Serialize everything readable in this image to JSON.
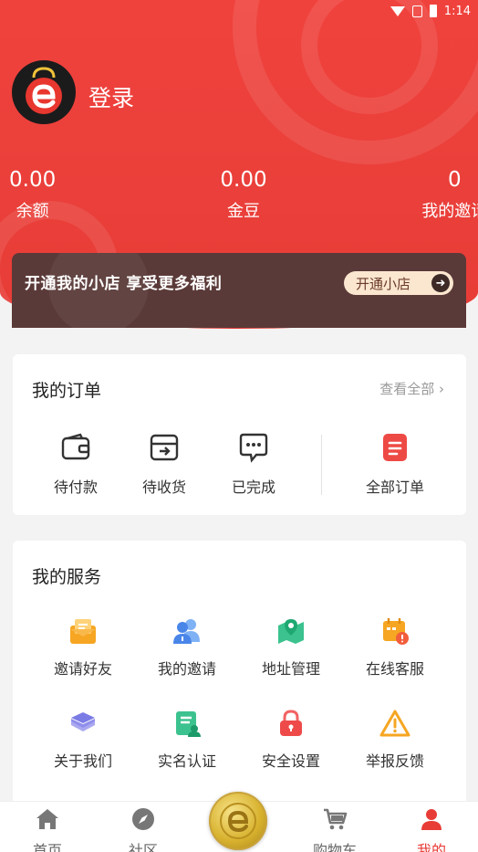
{
  "status_bar": {
    "time": "1:14"
  },
  "profile": {
    "login_label": "登录"
  },
  "stats": [
    {
      "value": "0.00",
      "label": "余额"
    },
    {
      "value": "0.00",
      "label": "金豆"
    },
    {
      "value": "0",
      "label": "我的邀请"
    }
  ],
  "shop_banner": {
    "text": "开通我的小店 享受更多福利",
    "button_label": "开通小店"
  },
  "orders": {
    "title": "我的订单",
    "view_all": "查看全部",
    "items": [
      {
        "label": "待付款",
        "icon": "wallet-icon"
      },
      {
        "label": "待收货",
        "icon": "receive-box-icon"
      },
      {
        "label": "已完成",
        "icon": "chat-dots-icon"
      },
      {
        "label": "全部订单",
        "icon": "document-icon"
      }
    ]
  },
  "services": {
    "title": "我的服务",
    "items": [
      {
        "label": "邀请好友",
        "icon": "mail-icon"
      },
      {
        "label": "我的邀请",
        "icon": "users-icon"
      },
      {
        "label": "地址管理",
        "icon": "map-pin-icon"
      },
      {
        "label": "在线客服",
        "icon": "calendar-alert-icon"
      },
      {
        "label": "关于我们",
        "icon": "layers-icon"
      },
      {
        "label": "实名认证",
        "icon": "id-card-icon"
      },
      {
        "label": "安全设置",
        "icon": "lock-icon"
      },
      {
        "label": "举报反馈",
        "icon": "warning-icon"
      }
    ]
  },
  "tabbar": {
    "items": [
      {
        "label": "首页",
        "icon": "home-icon"
      },
      {
        "label": "社区",
        "icon": "compass-icon"
      },
      {
        "label": "购物车",
        "icon": "cart-icon"
      },
      {
        "label": "我的",
        "icon": "user-icon",
        "active": true
      }
    ]
  },
  "colors": {
    "brand_red": "#ea3f3a",
    "active_tab": "#e83c36",
    "banner_dark": "#5a3a38",
    "button_cream": "#fbe6cf"
  }
}
